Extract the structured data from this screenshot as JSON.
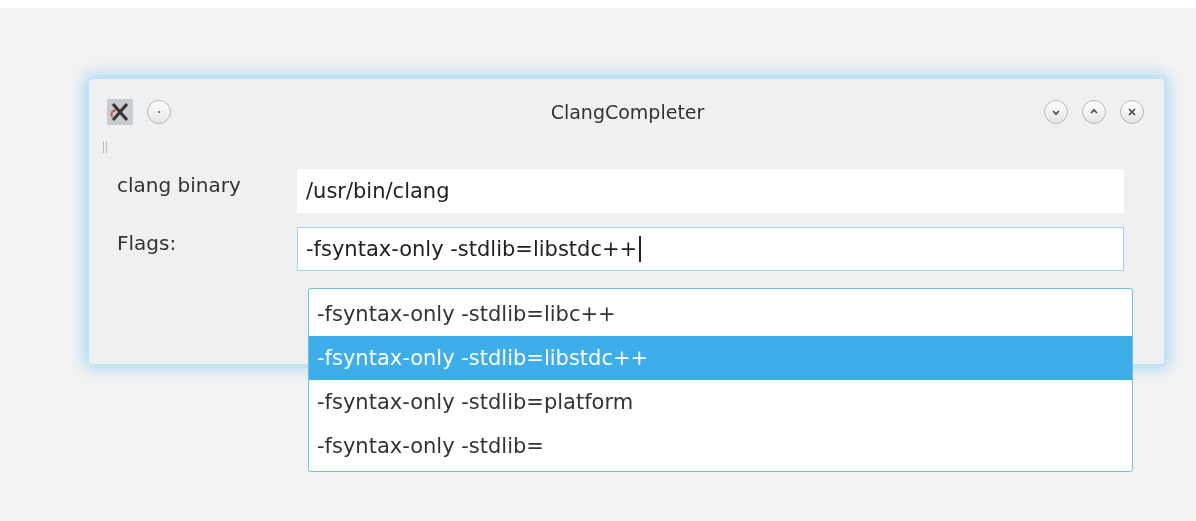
{
  "window": {
    "title": "ClangCompleter"
  },
  "form": [
    {
      "label": "clang binary",
      "value": "/usr/bin/clang",
      "focused": false
    },
    {
      "label": "Flags:",
      "value": "-fsyntax-only -stdlib=libstdc++",
      "focused": true
    }
  ],
  "completions": [
    {
      "text": "-fsyntax-only -stdlib=libc++",
      "selected": false
    },
    {
      "text": "-fsyntax-only -stdlib=libstdc++",
      "selected": true
    },
    {
      "text": "-fsyntax-only -stdlib=platform",
      "selected": false
    },
    {
      "text": "-fsyntax-only -stdlib=",
      "selected": false
    }
  ]
}
